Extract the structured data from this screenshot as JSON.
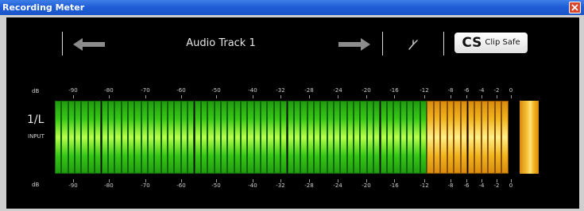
{
  "window": {
    "title": "Recording Meter",
    "close_icon": "close-icon"
  },
  "toolbar": {
    "track_name": "Audio Track 1",
    "prev_icon": "arrow-left-icon",
    "next_icon": "arrow-right-icon",
    "tuning_icon": "tuning-fork-icon",
    "clip_safe": {
      "mark": "CS",
      "label": "Clip Safe"
    }
  },
  "meter": {
    "unit_label": "dB",
    "channel": "1/L",
    "channel_source": "INPUT",
    "scale_labels": [
      "-90",
      "-80",
      "-70",
      "-60",
      "-50",
      "-40",
      "-32",
      "-28",
      "-24",
      "-20",
      "-16",
      "-12",
      "-8",
      "-6",
      "-4",
      "-2",
      "0"
    ],
    "level_db": 0,
    "peak_hold": true,
    "colors": {
      "green": "#38c816",
      "orange": "#f1b51e",
      "peak": "#ffe27a"
    }
  }
}
